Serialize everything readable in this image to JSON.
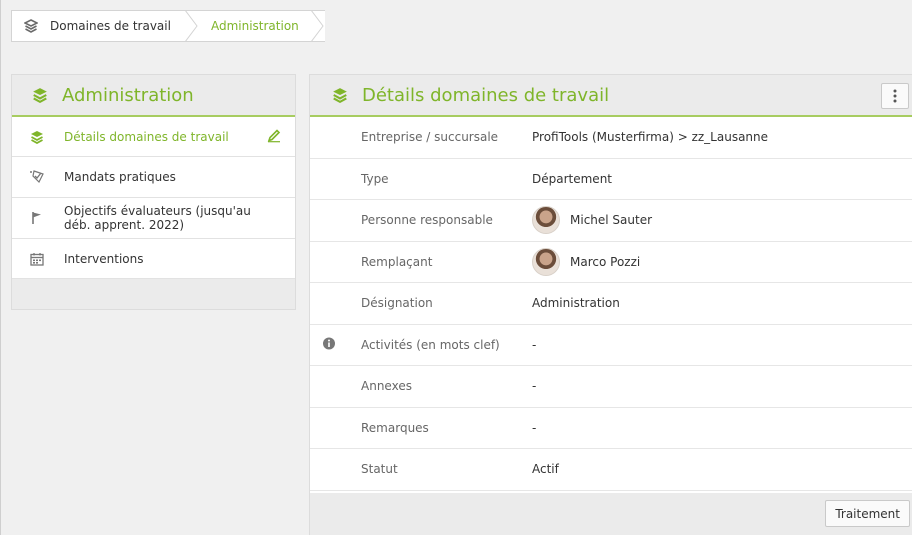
{
  "breadcrumb": {
    "items": [
      {
        "label": "Domaines de travail",
        "icon": "layers-icon"
      },
      {
        "label": "Administration"
      }
    ]
  },
  "left_panel": {
    "title": "Administration",
    "icon": "layers-icon",
    "items": [
      {
        "label": "Détails domaines de travail",
        "icon": "layers-icon",
        "active": true,
        "edit_icon": "pencil-icon"
      },
      {
        "label": "Mandats pratiques",
        "icon": "checklist-icon"
      },
      {
        "label": "Objectifs évaluateurs (jusqu'au déb. apprent. 2022)",
        "icon": "flag-icon"
      },
      {
        "label": "Interventions",
        "icon": "calendar-icon"
      }
    ]
  },
  "details": {
    "title": "Détails domaines de travail",
    "icon": "layers-icon",
    "more_icon": "vertical-dots-icon",
    "rows": [
      {
        "label": "Entreprise / succursale",
        "value": "ProfiTools (Musterfirma) > zz_Lausanne"
      },
      {
        "label": "Type",
        "value": "Département"
      },
      {
        "label": "Personne responsable",
        "value": "Michel Sauter",
        "avatar": true
      },
      {
        "label": "Remplaçant",
        "value": "Marco Pozzi",
        "avatar": true
      },
      {
        "label": "Désignation",
        "value": "Administration"
      },
      {
        "label": "Activités (en mots clef)",
        "value": "-",
        "info_icon": "info-icon"
      },
      {
        "label": "Annexes",
        "value": "-"
      },
      {
        "label": "Remarques",
        "value": "-"
      },
      {
        "label": "Statut",
        "value": "Actif"
      }
    ],
    "action_label": "Traitement"
  },
  "colors": {
    "accent": "#7fb52a",
    "header_bg": "#ebebeb",
    "page_bg": "#f0f0f0"
  }
}
